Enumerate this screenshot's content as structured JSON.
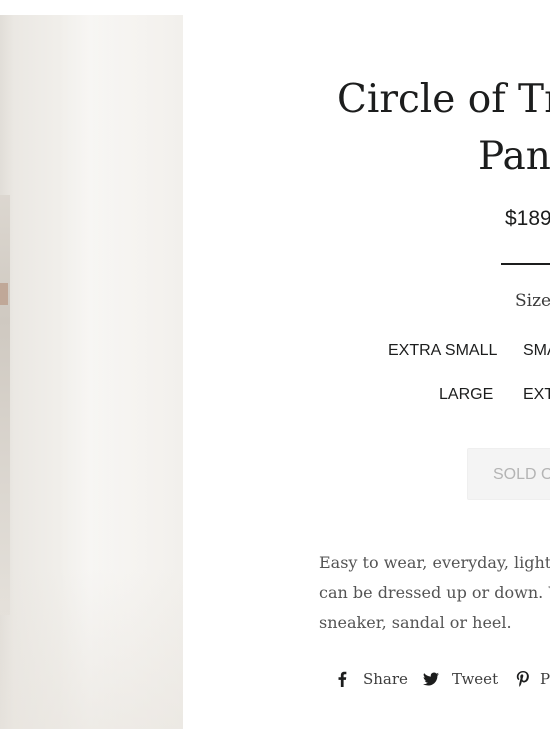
{
  "product": {
    "title_line1": "Circle of Tr",
    "title_line2": "Pan",
    "price": "$189"
  },
  "variant": {
    "size_label": "Size",
    "options": [
      "EXTRA SMALL",
      "SMA",
      "LARGE",
      "EXT"
    ]
  },
  "buy": {
    "sold_out_label": "SOLD OU"
  },
  "description": {
    "lines": [
      "Easy to wear, everyday, lightwe",
      "can be dressed up or down. We",
      "sneaker, sandal or heel."
    ]
  },
  "share": {
    "facebook_label": "Share",
    "twitter_label": "Tweet",
    "pinterest_label": "Pi",
    "icons": [
      "facebook-icon",
      "twitter-icon",
      "pinterest-icon"
    ]
  },
  "colors": {
    "text": "#1c1d1d",
    "muted_text": "#545454",
    "sold_out_bg": "#f4f4f4",
    "sold_out_text": "#b4b4b4"
  }
}
